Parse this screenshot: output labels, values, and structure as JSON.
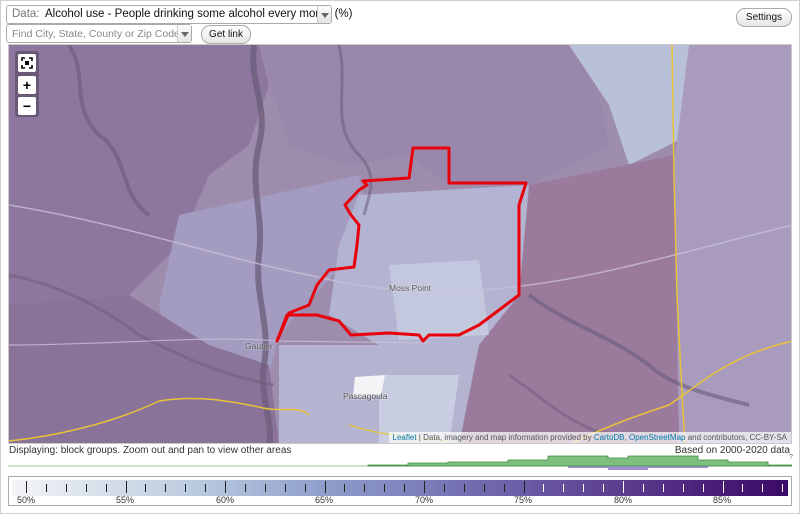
{
  "controls": {
    "data_prefix": "Data:",
    "data_value": "Alcohol use - People drinking some alcohol every month (%)",
    "find_placeholder": "Find City, State, County or Zip Code",
    "get_link_label": "Get link",
    "settings_label": "Settings"
  },
  "map": {
    "zoom_in": "+",
    "zoom_out": "−",
    "labels": {
      "moss_point": "Moss Point",
      "gautier": "Gautier",
      "pascagoula": "Pascagoula"
    },
    "attribution": {
      "leaflet": "Leaflet",
      "text": " | Data, imagery and map information provided by ",
      "carto": "CartoDB",
      "sep": ", ",
      "osm": "OpenStreetMap",
      "suffix": " and contributors, CC-BY-SA"
    },
    "colors": {
      "highlight_outline": "#e8000b",
      "road": "#e8c23a",
      "water": "#6b5c7a"
    }
  },
  "status": {
    "displaying": "Displaying: block groups. Zoom out and pan to view other areas",
    "based_on": "Based on 2000-2020 data",
    "help": "?"
  },
  "legend": {
    "labels": [
      "50%",
      "55%",
      "60%",
      "65%",
      "70%",
      "75%",
      "80%",
      "85%"
    ]
  }
}
